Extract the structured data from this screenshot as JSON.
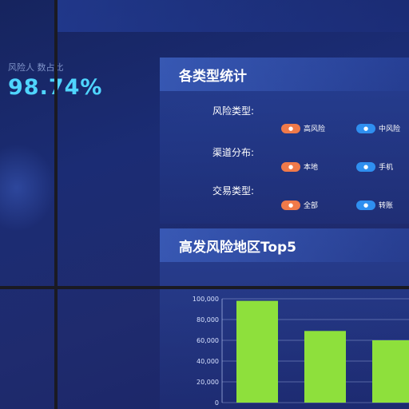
{
  "risk_stat": {
    "label": "风险人 数占比",
    "value": "98.74%"
  },
  "stats_panel": {
    "title": "各类型统计",
    "groups": [
      {
        "title": "风险类型:",
        "chips": [
          {
            "label": "高风险",
            "color": "orange"
          },
          {
            "label": "中风险",
            "color": "blue"
          }
        ]
      },
      {
        "title": "渠道分布:",
        "chips": [
          {
            "label": "本地",
            "color": "orange"
          },
          {
            "label": "手机",
            "color": "blue"
          }
        ]
      },
      {
        "title": "交易类型:",
        "chips": [
          {
            "label": "全部",
            "color": "orange"
          },
          {
            "label": "转账",
            "color": "blue"
          }
        ]
      }
    ]
  },
  "top5_panel": {
    "title": "高发风险地区Top5"
  },
  "chart_data": {
    "type": "bar",
    "categories": [
      "",
      "",
      ""
    ],
    "values": [
      98000,
      69000,
      60000
    ],
    "ylim": [
      0,
      100000
    ],
    "yticks": [
      "0",
      "20,000",
      "40,000",
      "60,000",
      "80,000",
      "100,000"
    ],
    "bar_color": "#8ee03c",
    "grid": true
  },
  "colors": {
    "background": "#1b2c74",
    "accent": "#4fd5ff",
    "chip_orange": "#f07a4a",
    "chip_blue": "#2f8ff0"
  }
}
